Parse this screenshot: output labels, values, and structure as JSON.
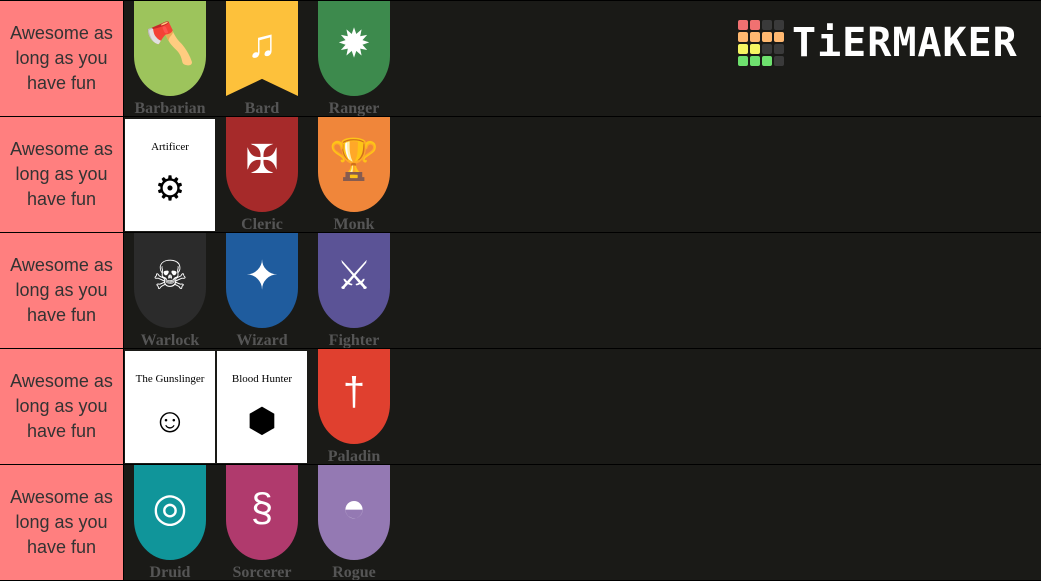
{
  "tiers": [
    {
      "label": "Awesome as long as you have fun",
      "items": [
        {
          "name": "Barbarian",
          "color": "#9dc45c",
          "icon": "axe-icon",
          "glyph": "🪓"
        },
        {
          "name": "Bard",
          "color": "#fdc13b",
          "icon": "lute-icon",
          "glyph": "♫",
          "banner": true
        },
        {
          "name": "Ranger",
          "color": "#3d8a4d",
          "icon": "paw-icon",
          "glyph": "✹"
        }
      ]
    },
    {
      "label": "Awesome as long as you have fun",
      "items": [
        {
          "name": "Artificer",
          "white": true,
          "icon": "gear-icon",
          "glyph": "⚙"
        },
        {
          "name": "Cleric",
          "color": "#a62a2a",
          "icon": "celtic-cross-icon",
          "glyph": "✠"
        },
        {
          "name": "Monk",
          "color": "#f0863a",
          "icon": "chalice-icon",
          "glyph": "🏆"
        }
      ]
    },
    {
      "label": "Awesome as long as you have fun",
      "items": [
        {
          "name": "Warlock",
          "color": "#2b2b2b",
          "icon": "skull-icon",
          "glyph": "☠"
        },
        {
          "name": "Wizard",
          "color": "#1f5c9e",
          "icon": "stars-flame-icon",
          "glyph": "✦"
        },
        {
          "name": "Fighter",
          "color": "#5b5396",
          "icon": "crossed-swords-icon",
          "glyph": "⚔"
        }
      ]
    },
    {
      "label": "Awesome as long as you have fun",
      "items": [
        {
          "name": "The Gunslinger",
          "white": true,
          "icon": "gunslinger-portrait-icon",
          "glyph": "☺"
        },
        {
          "name": "Blood Hunter",
          "white": true,
          "icon": "d20-icon",
          "glyph": "⬢"
        },
        {
          "name": "Paladin",
          "color": "#e0402f",
          "icon": "sword-laurel-icon",
          "glyph": "†"
        }
      ]
    },
    {
      "label": "Awesome as long as you have fun",
      "items": [
        {
          "name": "Druid",
          "color": "#10959a",
          "icon": "triskele-icon",
          "glyph": "◎"
        },
        {
          "name": "Sorcerer",
          "color": "#b03a6d",
          "icon": "swirl-icon",
          "glyph": "§"
        },
        {
          "name": "Rogue",
          "color": "#9479b3",
          "icon": "hood-icon",
          "glyph": "◓"
        }
      ]
    }
  ],
  "logo": {
    "text": "TiERMAKER",
    "grid": [
      "#f07171",
      "#f07171",
      "#3a3a3a",
      "#3a3a3a",
      "#ffb870",
      "#ffb870",
      "#ffb870",
      "#ffb870",
      "#f5f562",
      "#f5f562",
      "#3a3a3a",
      "#3a3a3a",
      "#6ee06e",
      "#6ee06e",
      "#6ee06e",
      "#3a3a3a"
    ]
  }
}
